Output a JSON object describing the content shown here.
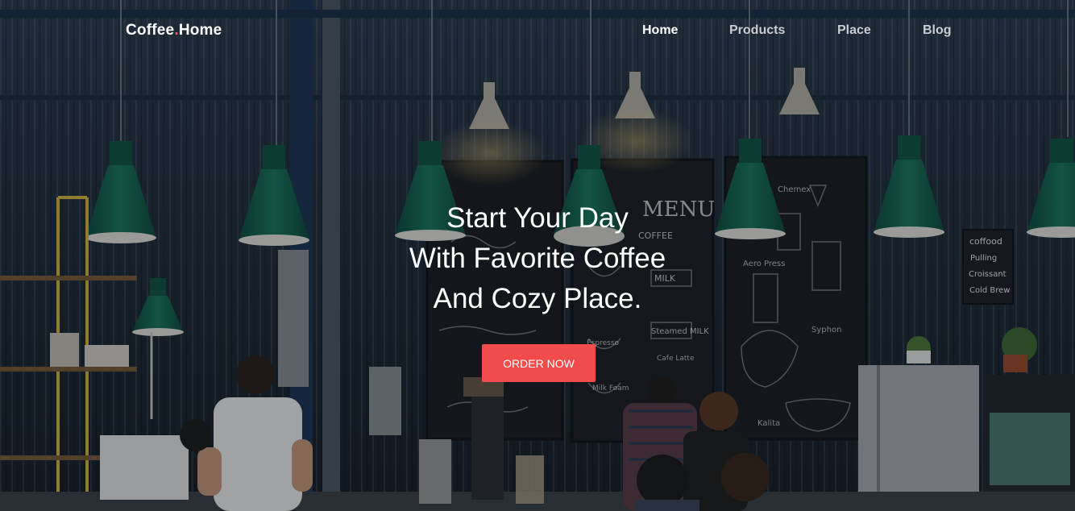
{
  "brand": {
    "name_part1": "Coffee",
    "dot": ".",
    "name_part2": "Home",
    "dot_color": "#f15a5a"
  },
  "nav": {
    "items": [
      {
        "label": "Home",
        "active": true
      },
      {
        "label": "Products",
        "active": false
      },
      {
        "label": "Place",
        "active": false
      },
      {
        "label": "Blog",
        "active": false
      }
    ]
  },
  "hero": {
    "headline_lines": [
      "Start Your Day",
      "With Favorite Coffee",
      "And Cozy Place."
    ],
    "cta_label": "ORDER NOW",
    "cta_color": "#f24b4b",
    "background_description_icon": "coffee-shop-interior-photo"
  },
  "chalkboard": {
    "menu_title": "MENU",
    "coffee_label": "COFFEE",
    "items": [
      "MILK",
      "Steamed MILK",
      "Espresso",
      "Milk Foam",
      "Cafe Latte",
      "Aero Press",
      "Syphon",
      "Chemex",
      "Kalita"
    ]
  },
  "signboard": {
    "lines": [
      "coffood",
      "Pulling",
      "Croissant",
      "Cold Brew"
    ]
  }
}
